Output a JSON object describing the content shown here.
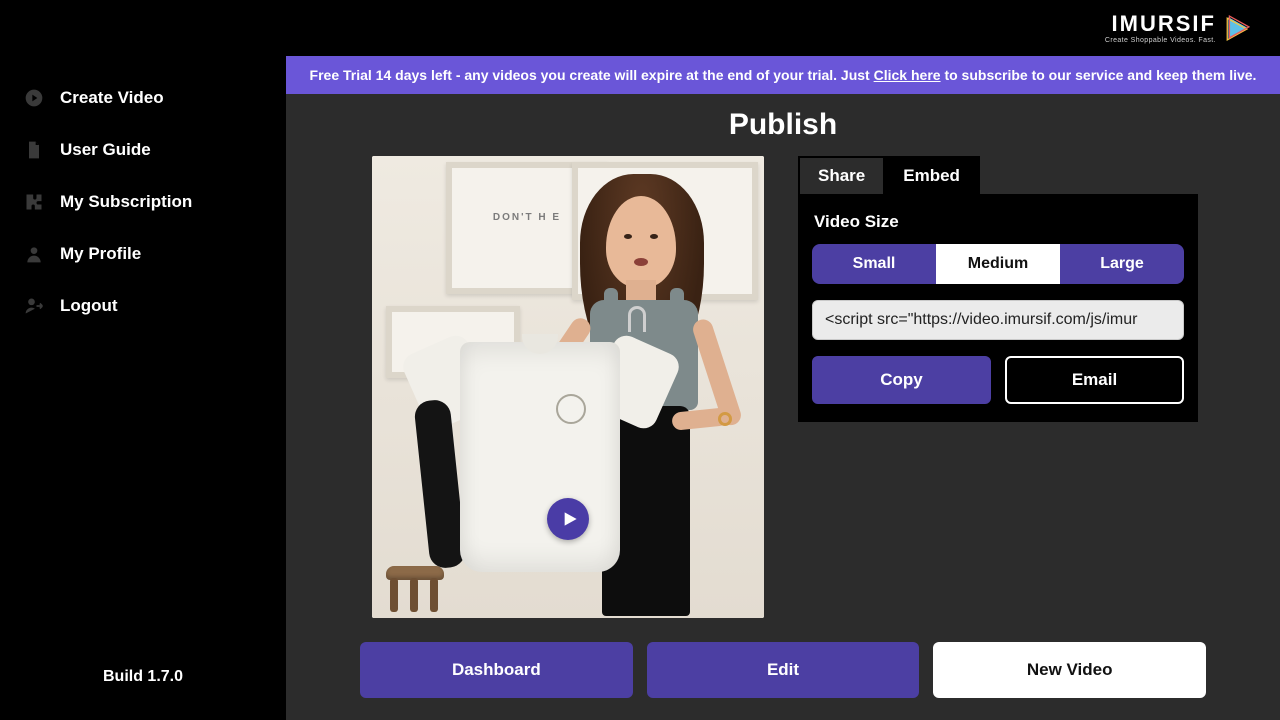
{
  "brand": {
    "name": "IMURSIF",
    "tagline": "Create Shoppable Videos. Fast."
  },
  "banner": {
    "before": "Free Trial 14 days left - any videos you create will expire at the end of your trial. Just ",
    "link": "Click here",
    "after": " to subscribe to our service and keep them live."
  },
  "sidebar": {
    "items": [
      {
        "label": "Create Video"
      },
      {
        "label": "User Guide"
      },
      {
        "label": "My Subscription"
      },
      {
        "label": "My Profile"
      },
      {
        "label": "Logout"
      }
    ],
    "build": "Build 1.7.0"
  },
  "page": {
    "title": "Publish"
  },
  "tabs": {
    "share": "Share",
    "embed": "Embed",
    "active": "embed"
  },
  "embed_panel": {
    "size_label": "Video Size",
    "sizes": {
      "small": "Small",
      "medium": "Medium",
      "large": "Large",
      "selected": "medium"
    },
    "code": "<script src=\"https://video.imursif.com/js/imur",
    "copy": "Copy",
    "email": "Email"
  },
  "bottom": {
    "dashboard": "Dashboard",
    "edit": "Edit",
    "new_video": "New Video"
  },
  "poster_text": "DON'T\nH   E"
}
